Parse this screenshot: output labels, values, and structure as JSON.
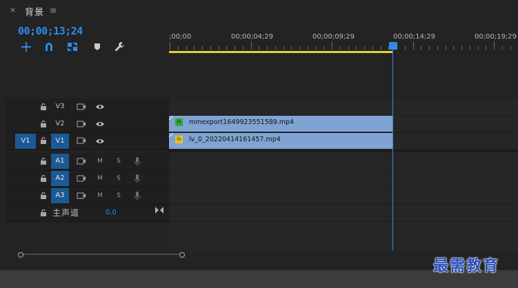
{
  "tab": {
    "title": "背景",
    "close_glyph": "×",
    "menu_glyph": "≡"
  },
  "timecode": "00;00;13;24",
  "toolbar": {
    "icons": [
      "nest-sequence-icon",
      "snap-icon",
      "linked-selection-icon",
      "add-marker-icon",
      "settings-wrench-icon"
    ]
  },
  "ruler": {
    "labels": [
      ";00;00",
      "00;00;04;29",
      "00;00;09;29",
      "00;00;14;29",
      "00;00;19;29"
    ]
  },
  "tracks": {
    "video": [
      {
        "name": "V3",
        "target": false
      },
      {
        "name": "V2",
        "target": false
      },
      {
        "name": "V1",
        "target": true,
        "source_patch": "V1"
      }
    ],
    "audio": [
      {
        "name": "A1",
        "m": "M",
        "s": "S"
      },
      {
        "name": "A2",
        "m": "M",
        "s": "S"
      },
      {
        "name": "A3",
        "m": "M",
        "s": "S"
      }
    ],
    "master": {
      "label": "主声道",
      "value": "0.0"
    }
  },
  "clips": [
    {
      "track": "V2",
      "name": "mmexport1649923551589.mp4",
      "fx": "fx",
      "fx_color": "#3aa83a"
    },
    {
      "track": "V1",
      "name": "lv_0_20220414161457.mp4",
      "fx": "fx",
      "fx_color": "#e6c229"
    }
  ],
  "watermark": "最需教育",
  "colors": {
    "accent": "#2d8ceb",
    "clip": "#7fa3d2",
    "workarea": "#e8d234",
    "track_target": "#1a5a96"
  }
}
